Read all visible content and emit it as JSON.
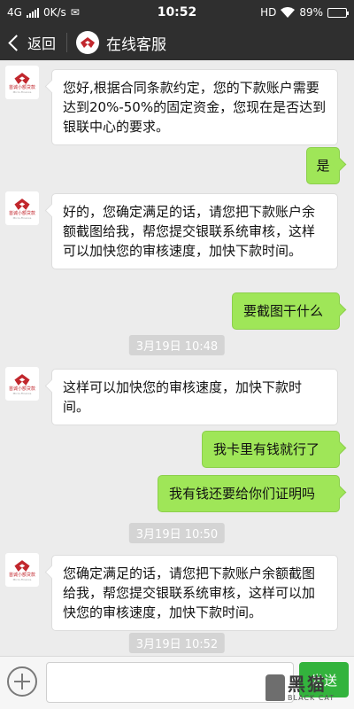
{
  "status_bar": {
    "network": "4G",
    "speed": "0K/s",
    "time": "10:52",
    "hd": "HD",
    "battery": "89%",
    "battery_level": 0.89
  },
  "nav": {
    "back_label": "返回",
    "title": "在线客服"
  },
  "agent": {
    "logo_text": "首诚小额贷款",
    "logo_sub": "Micro-Finance"
  },
  "messages": [
    {
      "side": "in",
      "text": "您好,根据合同条款约定，您的下款账户需要达到20%-50%的固定资金，您现在是否达到银联中心的要求。"
    },
    {
      "side": "out",
      "text": "是"
    },
    {
      "side": "in",
      "text": "好的，您确定满足的话，请您把下款账户余额截图给我，帮您提交银联系统审核，这样可以加快您的审核速度，加快下款时间。"
    },
    {
      "side": "out",
      "text": "要截图干什么"
    },
    {
      "side": "time",
      "text": "3月19日 10:48"
    },
    {
      "side": "in",
      "text": "这样可以加快您的审核速度，加快下款时间。"
    },
    {
      "side": "out",
      "text": "我卡里有钱就行了"
    },
    {
      "side": "out",
      "text": "我有钱还要给你们证明吗"
    },
    {
      "side": "time",
      "text": "3月19日 10:50"
    },
    {
      "side": "in",
      "text": "您确定满足的话，请您把下款账户余额截图给我，帮您提交银联系统审核，这样可以加快您的审核速度，加快下款时间。"
    },
    {
      "side": "time",
      "text": "3月19日 10:52"
    }
  ],
  "input": {
    "value": "",
    "send_label": "发送"
  },
  "watermark": {
    "main": "黑猫",
    "sub": "BLACK CAT"
  },
  "colors": {
    "bar_bg": "#2f2f2f",
    "chat_bg": "#ececec",
    "out_bubble": "#9fe658",
    "send_button": "#33b33d",
    "logo_red": "#c1272d"
  },
  "icons": [
    "back-chevron-icon",
    "plus-circle-icon",
    "agent-logo-icon",
    "wifi-icon",
    "signal-icon",
    "battery-icon"
  ]
}
